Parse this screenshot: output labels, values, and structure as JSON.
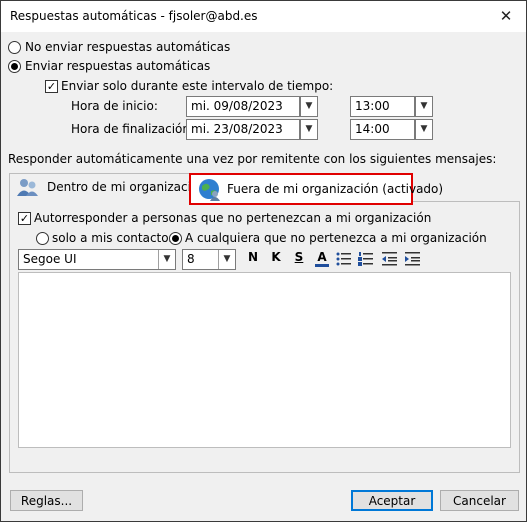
{
  "window": {
    "title": "Respuestas automáticas - fjsoler@abd.es",
    "close_glyph": "✕"
  },
  "reply_mode": {
    "no_send_label": "No enviar respuestas automáticas",
    "send_label": "Enviar respuestas automáticas",
    "selected": "send"
  },
  "interval": {
    "checkbox_label": "Enviar solo durante este intervalo de tiempo:",
    "checked": true,
    "start_label": "Hora de inicio:",
    "start_date": "mi. 09/08/2023",
    "start_time": "13:00",
    "end_label": "Hora de finalización:",
    "end_date": "mi. 23/08/2023",
    "end_time": "14:00"
  },
  "section_label": "Responder automáticamente una vez por remitente con los siguientes mensajes:",
  "tabs": [
    {
      "label": "Dentro de mi organización",
      "active": false
    },
    {
      "label": "Fuera de mi organización (activado)",
      "active": true
    }
  ],
  "outside": {
    "auto_reply_label": "Autorresponder a personas que no pertenezcan a mi organización",
    "auto_reply_checked": true,
    "contacts_only_label": "solo a mis contactos",
    "anyone_label": "A cualquiera que no pertenezca a mi organización",
    "selected_scope": "anyone"
  },
  "toolbar": {
    "font": "Segoe UI",
    "size": "8",
    "bold_label": "N",
    "italic_label": "K",
    "underline_label": "S",
    "font_color_label": "A",
    "accent_color": "#1f4e9c"
  },
  "message_body": "",
  "buttons": {
    "rules": "Reglas...",
    "accept": "Aceptar",
    "cancel": "Cancelar"
  }
}
